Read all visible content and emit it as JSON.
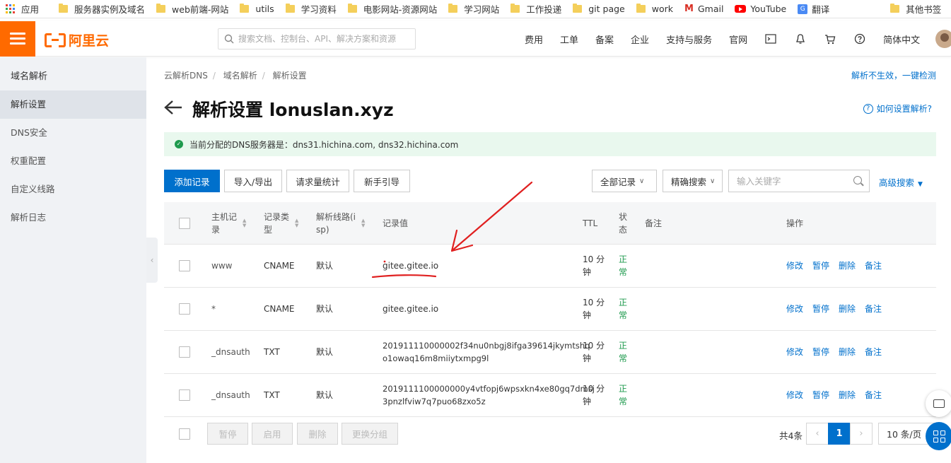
{
  "bookmarks": [
    {
      "label": "应用",
      "icon": "apps-grid-icon"
    },
    {
      "label": "服务器实例及域名",
      "icon": "folder-icon"
    },
    {
      "label": "web前端-网站",
      "icon": "folder-icon"
    },
    {
      "label": "utils",
      "icon": "folder-icon"
    },
    {
      "label": "学习资料",
      "icon": "folder-icon"
    },
    {
      "label": "电影网站-资源网站",
      "icon": "folder-icon"
    },
    {
      "label": "学习网站",
      "icon": "folder-icon"
    },
    {
      "label": "工作投递",
      "icon": "folder-icon"
    },
    {
      "label": "git page",
      "icon": "folder-icon"
    },
    {
      "label": "work",
      "icon": "folder-icon"
    },
    {
      "label": "Gmail",
      "icon": "gmail-icon"
    },
    {
      "label": "YouTube",
      "icon": "youtube-icon"
    },
    {
      "label": "翻译",
      "icon": "translate-icon"
    },
    {
      "label": "其他书签",
      "icon": "folder-icon"
    }
  ],
  "header": {
    "brand": "阿里云",
    "search_placeholder": "搜索文档、控制台、API、解决方案和资源",
    "links": [
      "费用",
      "工单",
      "备案",
      "企业",
      "支持与服务",
      "官网"
    ],
    "language": "简体中文"
  },
  "sidebar": {
    "title": "域名解析",
    "items": [
      {
        "label": "解析设置",
        "active": true
      },
      {
        "label": "DNS安全"
      },
      {
        "label": "权重配置"
      },
      {
        "label": "自定义线路"
      },
      {
        "label": "解析日志"
      }
    ]
  },
  "breadcrumb": [
    "云解析DNS",
    "域名解析",
    "解析设置"
  ],
  "help_link": "解析不生效，一键检测",
  "page_title": "解析设置 lonuslan.xyz",
  "howto_link": "如何设置解析?",
  "notice": "当前分配的DNS服务器是：dns31.hichina.com, dns32.hichina.com",
  "toolbar": {
    "add": "添加记录",
    "import_export": "导入/导出",
    "stats": "请求量统计",
    "guide": "新手引导",
    "filter": "全部记录",
    "search_mode": "精确搜索",
    "keyword_placeholder": "输入关键字",
    "advanced": "高级搜索"
  },
  "table": {
    "headers": {
      "host": [
        "主机记",
        "录"
      ],
      "type": [
        "记录类",
        "型"
      ],
      "line": [
        "解析线路(i",
        "sp)"
      ],
      "value": "记录值",
      "ttl": "TTL",
      "status": [
        "状",
        "态"
      ],
      "remark": "备注",
      "ops": "操作"
    },
    "rows": [
      {
        "host": "www",
        "type": "CNAME",
        "line": "默认",
        "value": [
          "gitee.gitee.io"
        ],
        "ttl": [
          "10 分",
          "钟"
        ],
        "status": [
          "正",
          "常"
        ]
      },
      {
        "host": "*",
        "type": "CNAME",
        "line": "默认",
        "value": [
          "gitee.gitee.io"
        ],
        "ttl": [
          "10 分",
          "钟"
        ],
        "status": [
          "正",
          "常"
        ]
      },
      {
        "host": "_dnsauth",
        "type": "TXT",
        "line": "默认",
        "value": [
          "201911110000002f34nu0nbgj8ifga39614jkymtshq",
          "o1owaq16m8miiytxmpg9l"
        ],
        "ttl": [
          "10 分",
          "钟"
        ],
        "status": [
          "正",
          "常"
        ]
      },
      {
        "host": "_dnsauth",
        "type": "TXT",
        "line": "默认",
        "value": [
          "2019111100000000y4vtfopj6wpsxkn4xe80gq7dmsj",
          "3pnzlfviw7q7puo68zxo5z"
        ],
        "ttl": [
          "10 分",
          "钟"
        ],
        "status": [
          "正",
          "常"
        ]
      }
    ],
    "actions": [
      "修改",
      "暂停",
      "删除",
      "备注"
    ]
  },
  "footer": {
    "batch": [
      "暂停",
      "启用",
      "删除",
      "更换分组"
    ],
    "total": "共4条",
    "page": "1",
    "page_size": "10 条/页"
  },
  "colors": {
    "brand": "#ff6a00",
    "primary": "#0070cc",
    "success": "#1e9a4d",
    "annotation": "#e02020"
  }
}
